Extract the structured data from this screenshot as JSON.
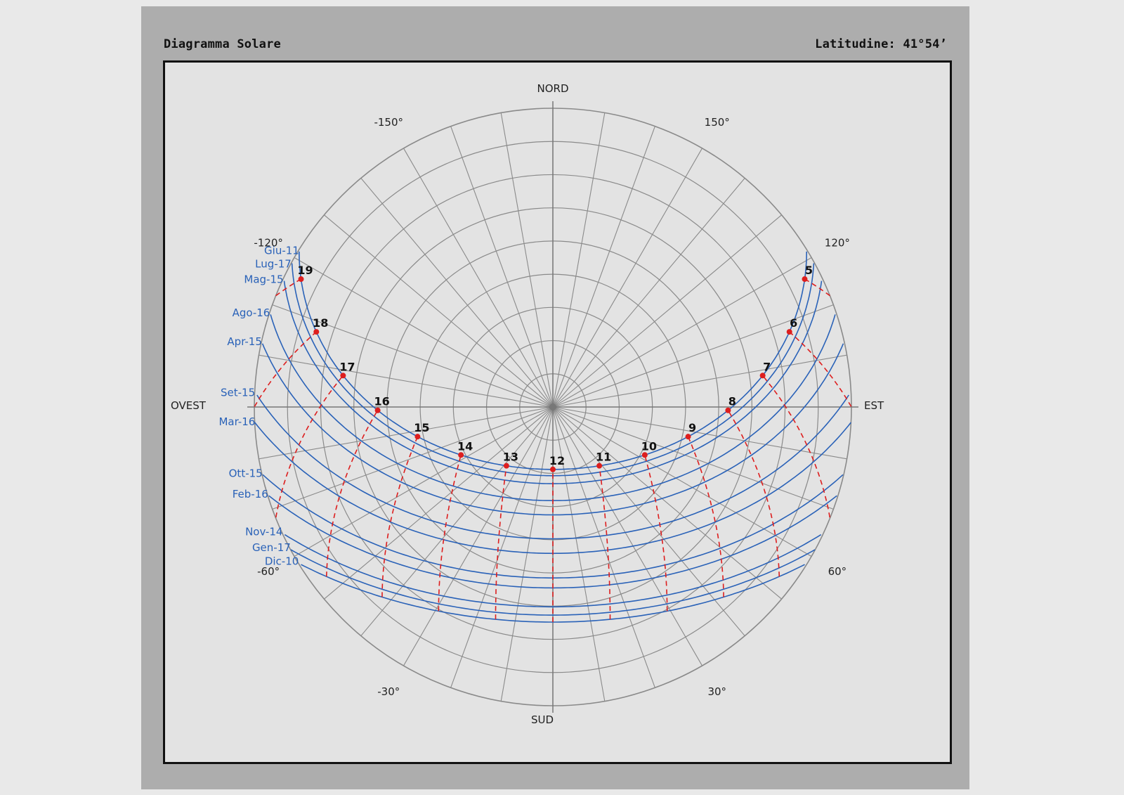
{
  "header": {
    "title": "Diagramma Solare",
    "latitude": "Latitudine: 41°54’"
  },
  "compass": {
    "north": "NORD",
    "south": "SUD",
    "east": "EST",
    "west": "OVEST"
  },
  "azimuth_labels": [
    {
      "deg": -150,
      "text": "-150°"
    },
    {
      "deg": 150,
      "text": "150°"
    },
    {
      "deg": -120,
      "text": "-120°"
    },
    {
      "deg": 120,
      "text": "120°"
    },
    {
      "deg": -60,
      "text": "-60°"
    },
    {
      "deg": 60,
      "text": "60°"
    },
    {
      "deg": -30,
      "text": "-30°"
    },
    {
      "deg": 30,
      "text": "30°"
    }
  ],
  "month_curves": [
    {
      "label": "Giu-11",
      "decl": 23.1
    },
    {
      "label": "Lug-17",
      "decl": 21.2
    },
    {
      "label": "Mag-15",
      "decl": 18.8
    },
    {
      "label": "Ago-16",
      "decl": 13.7
    },
    {
      "label": "Apr-15",
      "decl": 9.4
    },
    {
      "label": "Set-15",
      "decl": 2.2
    },
    {
      "label": "Mar-16",
      "decl": -2.2
    },
    {
      "label": "Ott-15",
      "decl": -9.6
    },
    {
      "label": "Feb-16",
      "decl": -12.6
    },
    {
      "label": "Nov-14",
      "decl": -18.3
    },
    {
      "label": "Gen-17",
      "decl": -20.8
    },
    {
      "label": "Dic-10",
      "decl": -22.9
    }
  ],
  "hours": [
    "5",
    "6",
    "7",
    "8",
    "9",
    "10",
    "11",
    "12",
    "13",
    "14",
    "15",
    "16",
    "17",
    "18",
    "19"
  ],
  "colors": {
    "month_curve": "#2a62b8",
    "hour_curve": "#dd1e1e",
    "grid": "#8a8a8a"
  },
  "latitude_deg": 41.9
}
